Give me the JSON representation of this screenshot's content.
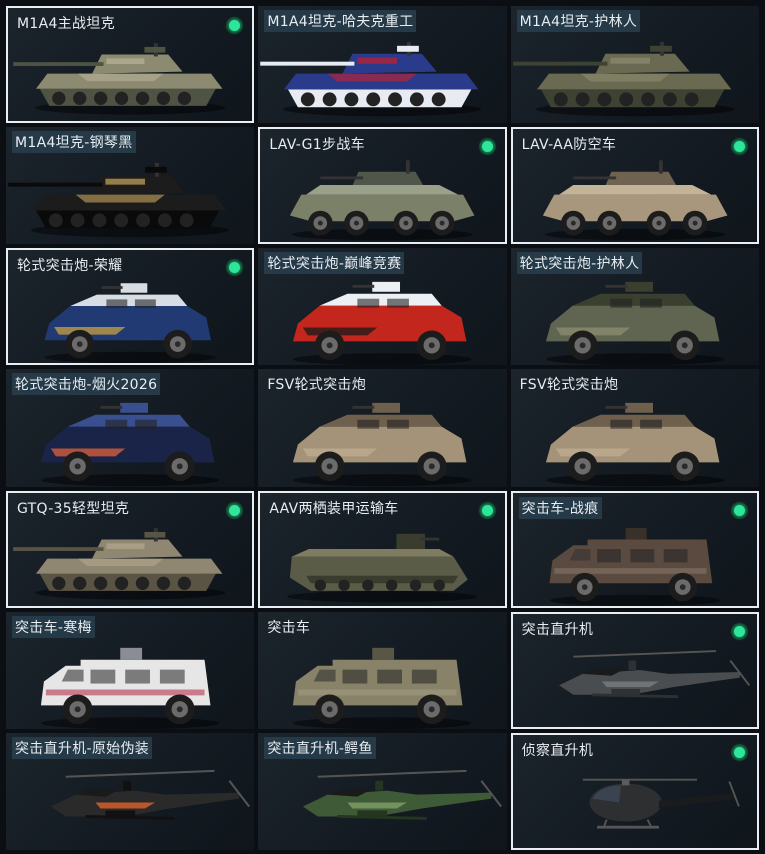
{
  "colors": {
    "selection_border": "#e9eef2",
    "owned_indicator": "#2ee59a",
    "card_bg": "#1a2128",
    "label_highlight": "#2a3e4e"
  },
  "vehicles": [
    {
      "name": "M1A4主战坦克",
      "kind": "tank",
      "selected": true,
      "owned": true,
      "highlight": false,
      "c1": "#8c8a70",
      "c2": "#4e5344",
      "c3": "#b7b39a"
    },
    {
      "name": "M1A4坦克-哈夫克重工",
      "kind": "tank",
      "selected": false,
      "owned": false,
      "highlight": true,
      "c1": "#2b3b8c",
      "c2": "#e8ecf2",
      "c3": "#c7202a"
    },
    {
      "name": "M1A4坦克-护林人",
      "kind": "tank",
      "selected": false,
      "owned": false,
      "highlight": true,
      "c1": "#6a6a52",
      "c2": "#3d4232",
      "c3": "#8e8c70"
    },
    {
      "name": "M1A4坦克-钢琴黑",
      "kind": "tank",
      "selected": false,
      "owned": false,
      "highlight": true,
      "c1": "#1c1c1c",
      "c2": "#0a0a0a",
      "c3": "#c9a75c"
    },
    {
      "name": "LAV-G1步战车",
      "kind": "apc",
      "selected": true,
      "owned": true,
      "highlight": false,
      "c1": "#7b8069",
      "c2": "#50564a",
      "c3": "#9aa08a"
    },
    {
      "name": "LAV-AA防空车",
      "kind": "apc",
      "selected": true,
      "owned": true,
      "highlight": false,
      "c1": "#a8977c",
      "c2": "#6f6250",
      "c3": "#c3b398"
    },
    {
      "name": "轮式突击炮-荣耀",
      "kind": "mrap",
      "selected": true,
      "owned": true,
      "highlight": false,
      "c1": "#213a74",
      "c2": "#d8dce3",
      "c3": "#c9a040"
    },
    {
      "name": "轮式突击炮-巅峰竞赛",
      "kind": "mrap",
      "selected": false,
      "owned": false,
      "highlight": true,
      "c1": "#c2261c",
      "c2": "#eceff3",
      "c3": "#1a1a1a"
    },
    {
      "name": "轮式突击炮-护林人",
      "kind": "mrap",
      "selected": false,
      "owned": false,
      "highlight": true,
      "c1": "#5f6550",
      "c2": "#3a3f30",
      "c3": "#8e8e70"
    },
    {
      "name": "轮式突击炮-烟火2026",
      "kind": "mrap",
      "selected": false,
      "owned": false,
      "highlight": true,
      "c1": "#1a2448",
      "c2": "#3a4f8f",
      "c3": "#e0603a"
    },
    {
      "name": "FSV轮式突击炮",
      "kind": "mrap",
      "selected": false,
      "owned": false,
      "highlight": false,
      "c1": "#a59379",
      "c2": "#6f604e",
      "c3": "#c0ae92"
    },
    {
      "name": "FSV轮式突击炮",
      "kind": "mrap",
      "selected": false,
      "owned": false,
      "highlight": false,
      "c1": "#a59379",
      "c2": "#6f604e",
      "c3": "#c0ae92"
    },
    {
      "name": "GTQ-35轻型坦克",
      "kind": "tank",
      "selected": true,
      "owned": true,
      "highlight": false,
      "c1": "#8f8771",
      "c2": "#5a5444",
      "c3": "#b2a88e"
    },
    {
      "name": "AAV两栖装甲运输车",
      "kind": "aav",
      "selected": true,
      "owned": true,
      "highlight": false,
      "c1": "#5a5c48",
      "c2": "#3a3c2e",
      "c3": "#7f7c62"
    },
    {
      "name": "突击车-战痕",
      "kind": "truck",
      "selected": true,
      "owned": true,
      "highlight": true,
      "c1": "#5a4a40",
      "c2": "#3a302a",
      "c3": "#8a7a6a"
    },
    {
      "name": "突击车-寒梅",
      "kind": "truck",
      "selected": false,
      "owned": false,
      "highlight": true,
      "c1": "#e6e6e6",
      "c2": "#8a8e94",
      "c3": "#b02040"
    },
    {
      "name": "突击车",
      "kind": "truck",
      "selected": false,
      "owned": false,
      "highlight": false,
      "c1": "#888268",
      "c2": "#5a5646",
      "c3": "#a49e84"
    },
    {
      "name": "突击直升机",
      "kind": "heli",
      "selected": true,
      "owned": true,
      "highlight": false,
      "c1": "#4a4d4f",
      "c2": "#2e3133",
      "c3": "#7a7e80"
    },
    {
      "name": "突击直升机-原始伪装",
      "kind": "heli",
      "selected": false,
      "owned": false,
      "highlight": true,
      "c1": "#2a2a2a",
      "c2": "#111111",
      "c3": "#e0622a"
    },
    {
      "name": "突击直升机-鳄鱼",
      "kind": "heli",
      "selected": false,
      "owned": false,
      "highlight": true,
      "c1": "#3f5a36",
      "c2": "#24361f",
      "c3": "#7fa06a"
    },
    {
      "name": "侦察直升机",
      "kind": "scout",
      "selected": true,
      "owned": true,
      "highlight": false,
      "c1": "#2e2f31",
      "c2": "#1a1b1d",
      "c3": "#5a5c60"
    }
  ]
}
